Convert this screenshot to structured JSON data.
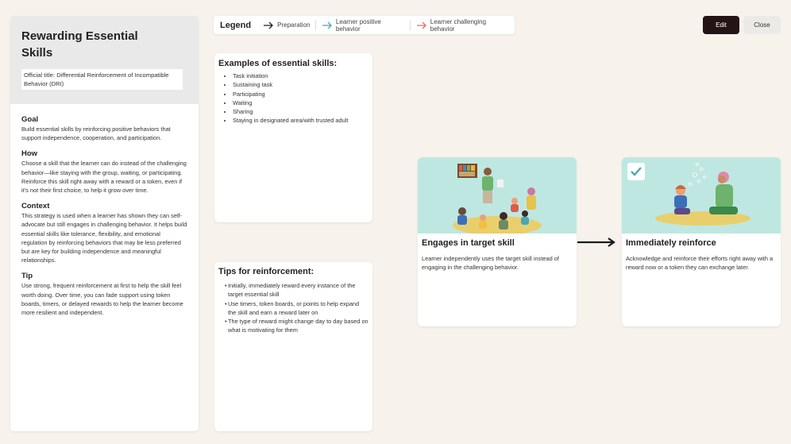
{
  "header": {
    "legend_title": "Legend",
    "legend_items": [
      "Preparation",
      "Learner positive behavior",
      "Learner challenging behavior"
    ],
    "edit_label": "Edit",
    "close_label": "Close"
  },
  "colors": {
    "preparation": "#222222",
    "positive": "#4aa8b4",
    "challenging": "#e0715e",
    "edit_bg": "#241415"
  },
  "panel": {
    "title": "Rewarding Essential Skills",
    "official_title": "Official title: Differential Reinforcement of Incompatible Behavior (DRI)",
    "sections": [
      {
        "heading": "Goal",
        "text": "Build essential skills by reinforcing positive behaviors that support independence, cooperation, and participation."
      },
      {
        "heading": "How",
        "text": "Choose a skill that the learner can do instead of the challenging behavior—like staying with the group, waiting, or participating. Reinforce this skill right away with a reward or a token, even if it's not their first choice, to help it grow over time."
      },
      {
        "heading": "Context",
        "text": "This strategy is used when a learner has shown they can self-advocate but still engages in challenging behavior. It helps build essential skills like tolerance, flexibility, and emotional regulation by reinforcing behaviors that may be less preferred but are key for building independence and meaningful relationships."
      },
      {
        "heading": "Tip",
        "text": "Use strong, frequent reinforcement at first to help the skill feel worth doing. Over time, you can fade support using token boards, timers, or delayed rewards to help the learner become more resilient and independent."
      }
    ]
  },
  "skills_card": {
    "title": "Examples of essential skills:",
    "items": [
      "Task initiation",
      "Sustaining task",
      "Participating",
      "Waiting",
      "Sharing",
      "Staying in designated area/with trusted adult"
    ]
  },
  "tips_card": {
    "title": "Tips for reinforcement:",
    "items": [
      "Initially, immediately reward every instance of the target essential skill",
      "Use timers, token boards, or points to help expand the skill and earn a reward later on",
      "The type of reward might change day to day based on what is motivating for them"
    ]
  },
  "flow": [
    {
      "title": "Engages in target skill",
      "text": "Learner independently uses the target skill instead of engaging in the challenging behavior."
    },
    {
      "title": "Immediately reinforce",
      "text": "Acknowledge and reinforce their efforts right away with a reward now or a token they can exchange later."
    }
  ]
}
